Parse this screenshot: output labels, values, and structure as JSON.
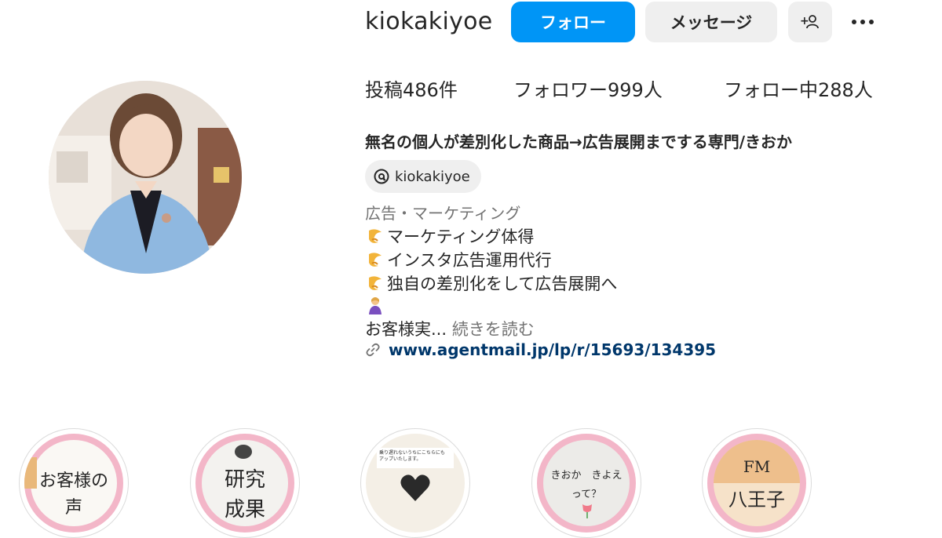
{
  "profile": {
    "username": "kiokakiyoe",
    "follow_label": "フォロー",
    "message_label": "メッセージ",
    "add_user_label": "+",
    "colors": {
      "follow_blue": "#0095f6",
      "secondary_bg": "#efefef",
      "link_color": "#00376b"
    }
  },
  "stats": {
    "posts_prefix": "投稿",
    "posts_count": "486",
    "posts_suffix": "件",
    "followers_prefix": "フォロワー",
    "followers_count": "999",
    "followers_suffix": "人",
    "following_prefix": "フォロー中",
    "following_count": "288",
    "following_suffix": "人"
  },
  "bio": {
    "name": "無名の個人が差別化した商品→広告展開までする専門/きおか",
    "threads_handle": "kiokakiyoe",
    "category": "広告・マーケティング",
    "lines": [
      "マーケティング体得",
      "インスタ広告運用代行",
      "独自の差別化をして広告展開へ"
    ],
    "truncated_text": "お客様実...",
    "more_label": "続きを読む",
    "link": "www.agentmail.jp/lp/r/15693/134395"
  },
  "highlights": [
    {
      "text_line1": "お客様の",
      "text_line2": "声"
    },
    {
      "text_line1": "研究",
      "text_line2": "成果"
    },
    {
      "text_line1": "乗り遅れないうちにこちらにも",
      "text_line2": "アップいたします。"
    },
    {
      "text_line1": "きおか　きよえ",
      "text_line2": "って？"
    },
    {
      "text_line1": "FM",
      "text_line2": "八王子"
    }
  ],
  "icons": [
    "add-user-icon",
    "more-icon",
    "threads-icon",
    "link-icon",
    "hourglass-emoji-icon",
    "person-emoji-icon"
  ]
}
